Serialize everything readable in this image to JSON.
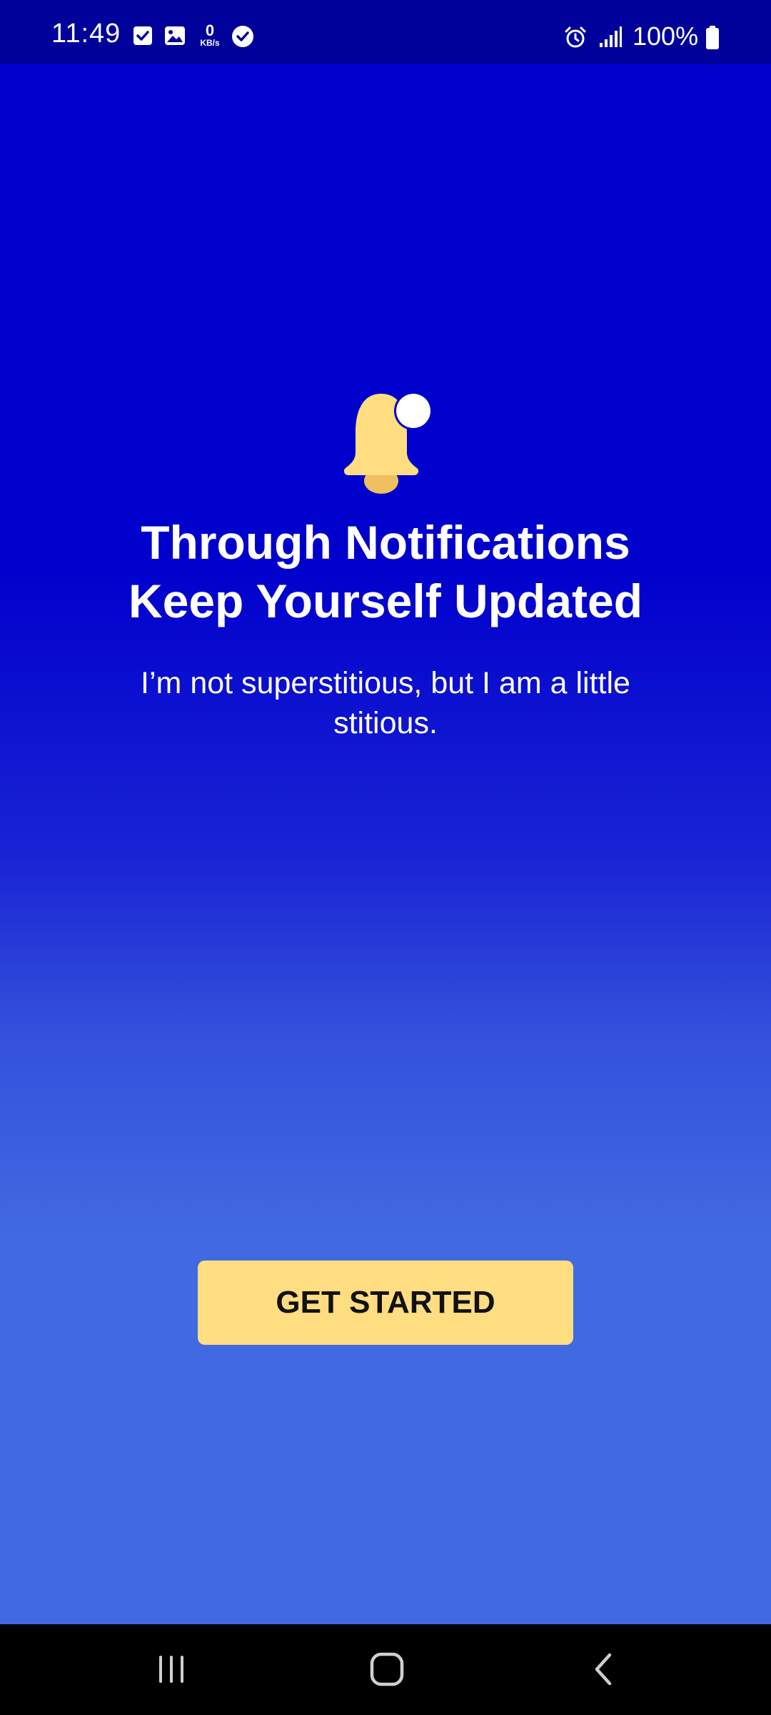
{
  "status_bar": {
    "time": "11:49",
    "net_speed_value": "0",
    "net_speed_unit": "KB/s",
    "battery": "100%",
    "icons": [
      "checkbox-icon",
      "image-icon",
      "check-circle-icon",
      "alarm-icon",
      "signal-icon",
      "battery-icon"
    ]
  },
  "onboarding": {
    "icon": "bell-icon",
    "headline_line1": "Through Notifications",
    "headline_line2": "Keep Yourself Updated",
    "subtext": "I’m not superstitious, but I am a little stitious.",
    "cta_label": "GET STARTED"
  },
  "nav_bar": {
    "buttons": [
      "recent-apps-icon",
      "home-icon",
      "back-icon"
    ]
  },
  "colors": {
    "background_top": "#0000cc",
    "background_bottom": "#4169e1",
    "status_bar": "#00009a",
    "accent": "#ffdd80",
    "text": "#ffffff"
  }
}
